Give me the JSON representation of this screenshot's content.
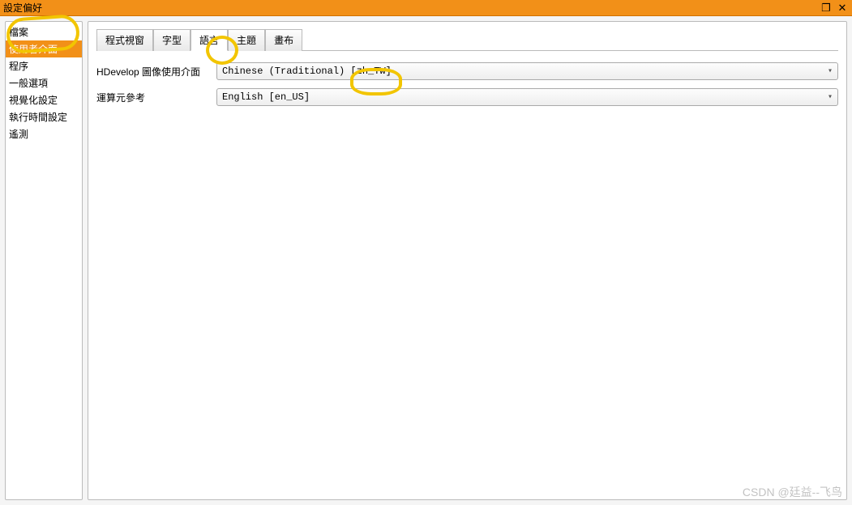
{
  "window": {
    "title": "設定偏好",
    "restore_label": "❐",
    "close_label": "✕"
  },
  "sidebar": {
    "items": [
      {
        "label": "檔案",
        "selected": false
      },
      {
        "label": "使用者介面",
        "selected": true
      },
      {
        "label": "程序",
        "selected": false
      },
      {
        "label": "一般選項",
        "selected": false
      },
      {
        "label": "視覺化設定",
        "selected": false
      },
      {
        "label": "執行時間設定",
        "selected": false
      },
      {
        "label": "遙測",
        "selected": false
      }
    ]
  },
  "tabs": [
    {
      "label": "程式視窗",
      "active": false
    },
    {
      "label": "字型",
      "active": false
    },
    {
      "label": "語言",
      "active": true
    },
    {
      "label": "主題",
      "active": false
    },
    {
      "label": "畫布",
      "active": false
    }
  ],
  "form": {
    "row1": {
      "label": "HDevelop 圖像使用介面",
      "value": "Chinese (Traditional) [zh_TW]"
    },
    "row2": {
      "label": "運算元參考",
      "value": "English [en_US]"
    }
  },
  "combobox_arrow": "▾",
  "watermark": "CSDN @廷益--飞鸟"
}
